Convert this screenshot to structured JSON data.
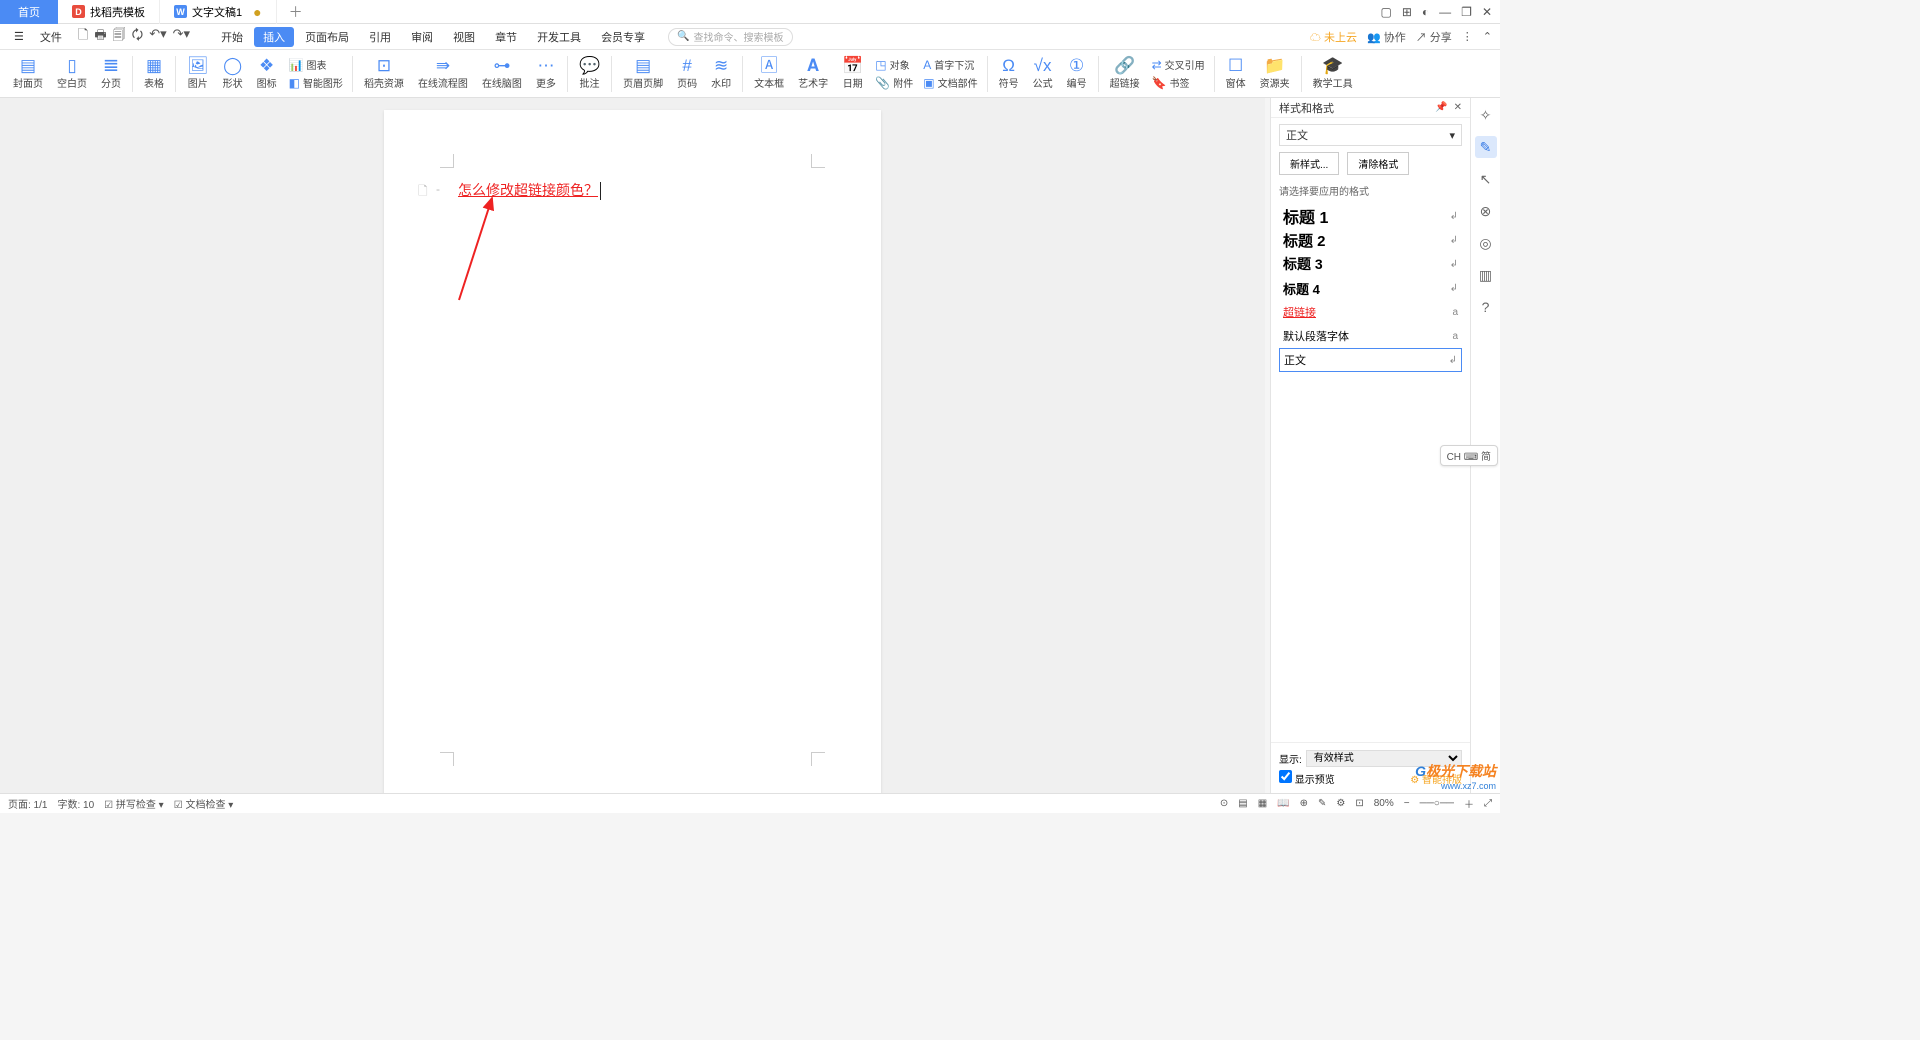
{
  "tabs": {
    "home": "首页",
    "templates": "找稻壳模板",
    "doc": "文字文稿1"
  },
  "file_menu": "文件",
  "menu_items": [
    "开始",
    "插入",
    "页面布局",
    "引用",
    "审阅",
    "视图",
    "章节",
    "开发工具",
    "会员专享"
  ],
  "menu_active_index": 1,
  "search_placeholder": "查找命令、搜索模板",
  "top_right": {
    "cloud": "未上云",
    "collab": "协作",
    "share": "分享"
  },
  "ribbon": {
    "items": [
      "封面页",
      "空白页",
      "分页",
      "表格",
      "图片",
      "形状",
      "图标",
      "智能图形",
      "稻壳资源",
      "在线流程图",
      "在线脑图",
      "更多",
      "批注",
      "页眉页脚",
      "页码",
      "水印",
      "文本框",
      "艺术字",
      "日期",
      "附件",
      "文档部件",
      "符号",
      "公式",
      "编号",
      "超链接",
      "书签",
      "窗体",
      "资源夹",
      "教学工具"
    ],
    "chart": "图表",
    "object": "对象",
    "dropcap": "首字下沉",
    "crossref": "交叉引用"
  },
  "document": {
    "hyperlink_text": "怎么修改超链接颜色？"
  },
  "panel": {
    "title": "样式和格式",
    "current_style": "正文",
    "new_style": "新样式...",
    "clear_format": "清除格式",
    "hint": "请选择要应用的格式",
    "styles": {
      "h1": "标题 1",
      "h2": "标题 2",
      "h3": "标题 3",
      "h4": "标题 4",
      "link": "超链接",
      "default_font": "默认段落字体",
      "body": "正文"
    },
    "show_label": "显示:",
    "show_value": "有效样式",
    "preview": "显示预览",
    "smart": "智能排版"
  },
  "ime": "CH ⌨ 简",
  "watermark": {
    "logo_g": "G",
    "logo_rest": "极光下载站",
    "url": "www.xz7.com"
  },
  "status": {
    "page": "页面: 1/1",
    "words": "字数: 10",
    "spell": "拼写检查",
    "content": "文档检查",
    "zoom": "80%"
  }
}
